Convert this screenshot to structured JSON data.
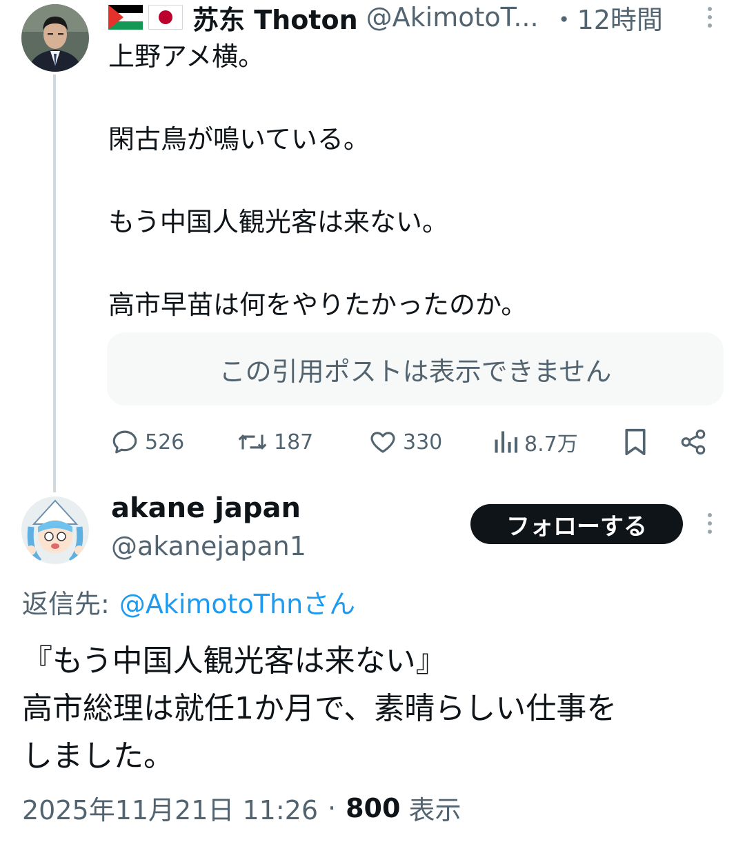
{
  "post": {
    "flags": [
      "palestine-flag",
      "japan-flag"
    ],
    "display_name": "苏东 Thoton",
    "handle": "@AkimotoT...",
    "time": "・12時間",
    "text": "上野アメ横。\n\n閑古鳥が鳴いている。\n\nもう中国人観光客は来ない。\n\n高市早苗は何をやりたかったのか。",
    "quote_unavailable": "この引用ポストは表示できません",
    "actions": {
      "replies": "526",
      "reposts": "187",
      "likes": "330",
      "views": "8.7万"
    }
  },
  "reply": {
    "display_name": "akane japan",
    "handle": "@akanejapan1",
    "follow_label": "フォローする",
    "reply_to_prefix": "返信先:",
    "reply_to_mention": "@AkimotoThnさん",
    "text": "『もう中国人観光客は来ない』\n高市総理は就任1か月で、素晴らしい仕事を\nしました。",
    "timestamp": "2025年11月21日 11:26",
    "separator": "·",
    "views_count": "800",
    "views_label": "表示"
  },
  "colors": {
    "text_primary": "#0f1419",
    "text_secondary": "#536471",
    "link": "#1d9bf0",
    "quote_bg": "#f7f9f9",
    "thread_line": "#cfd9de",
    "follow_bg": "#0f1419"
  }
}
